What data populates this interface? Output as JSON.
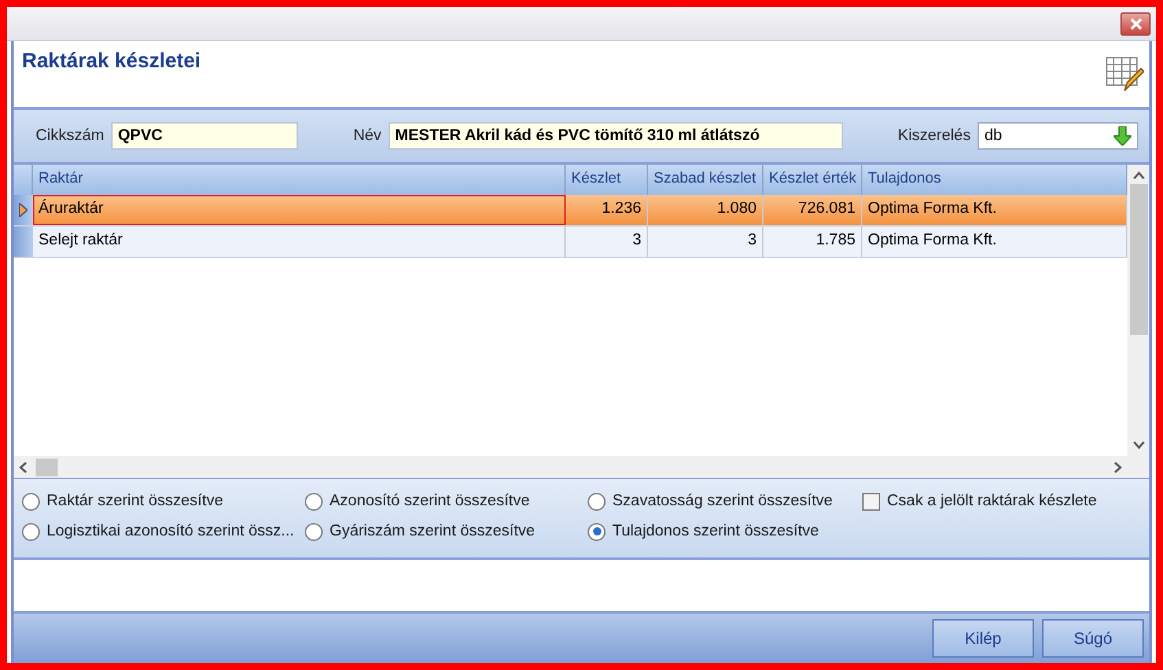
{
  "window": {
    "title": "Raktárak készletei"
  },
  "filters": [
    {
      "label": "Cikkszám",
      "value": "QPVC",
      "kind": "text"
    },
    {
      "label": "Név",
      "value": "MESTER Akril kád és PVC tömítő 310 ml átlátszó",
      "kind": "text"
    },
    {
      "label": "Kiszerelés",
      "value": "db",
      "kind": "dropdown"
    }
  ],
  "table": {
    "columns": [
      {
        "label": "Raktár"
      },
      {
        "label": "Készlet"
      },
      {
        "label": "Szabad készlet"
      },
      {
        "label": "Készlet érték"
      },
      {
        "label": "Tulajdonos"
      }
    ],
    "rows": [
      {
        "selected": true,
        "cells": [
          "Áruraktár",
          "1.236",
          "1.080",
          "726.081",
          "Optima Forma Kft."
        ]
      },
      {
        "selected": false,
        "cells": [
          "Selejt raktár",
          "3",
          "3",
          "1.785",
          "Optima Forma Kft."
        ]
      }
    ]
  },
  "options": [
    {
      "kind": "radio",
      "label": "Raktár szerint összesítve",
      "selected": false
    },
    {
      "kind": "radio",
      "label": "Azonosító szerint összesítve",
      "selected": false
    },
    {
      "kind": "radio",
      "label": "Szavatosság szerint összesítve",
      "selected": false
    },
    {
      "kind": "checkbox",
      "label": "Csak a jelölt raktárak készlete",
      "checked": false
    },
    {
      "kind": "radio",
      "label": "Logisztikai azonosító szerint össz...",
      "selected": false
    },
    {
      "kind": "radio",
      "label": "Gyáriszám szerint összesítve",
      "selected": false
    },
    {
      "kind": "radio",
      "label": "Tulajdonos szerint összesítve",
      "selected": true
    }
  ],
  "buttons": [
    "Kilép",
    "Súgó"
  ]
}
